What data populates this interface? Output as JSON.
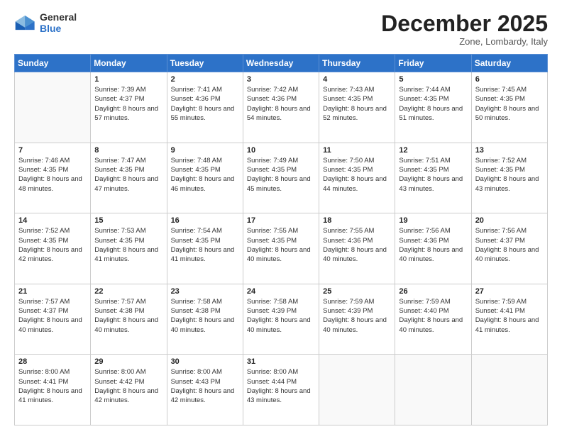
{
  "header": {
    "logo_line1": "General",
    "logo_line2": "Blue",
    "month": "December 2025",
    "location": "Zone, Lombardy, Italy"
  },
  "weekdays": [
    "Sunday",
    "Monday",
    "Tuesday",
    "Wednesday",
    "Thursday",
    "Friday",
    "Saturday"
  ],
  "weeks": [
    [
      {
        "day": "",
        "empty": true
      },
      {
        "day": "1",
        "sunrise": "7:39 AM",
        "sunset": "4:37 PM",
        "daylight": "8 hours and 57 minutes."
      },
      {
        "day": "2",
        "sunrise": "7:41 AM",
        "sunset": "4:36 PM",
        "daylight": "8 hours and 55 minutes."
      },
      {
        "day": "3",
        "sunrise": "7:42 AM",
        "sunset": "4:36 PM",
        "daylight": "8 hours and 54 minutes."
      },
      {
        "day": "4",
        "sunrise": "7:43 AM",
        "sunset": "4:35 PM",
        "daylight": "8 hours and 52 minutes."
      },
      {
        "day": "5",
        "sunrise": "7:44 AM",
        "sunset": "4:35 PM",
        "daylight": "8 hours and 51 minutes."
      },
      {
        "day": "6",
        "sunrise": "7:45 AM",
        "sunset": "4:35 PM",
        "daylight": "8 hours and 50 minutes."
      }
    ],
    [
      {
        "day": "7",
        "sunrise": "7:46 AM",
        "sunset": "4:35 PM",
        "daylight": "8 hours and 48 minutes."
      },
      {
        "day": "8",
        "sunrise": "7:47 AM",
        "sunset": "4:35 PM",
        "daylight": "8 hours and 47 minutes."
      },
      {
        "day": "9",
        "sunrise": "7:48 AM",
        "sunset": "4:35 PM",
        "daylight": "8 hours and 46 minutes."
      },
      {
        "day": "10",
        "sunrise": "7:49 AM",
        "sunset": "4:35 PM",
        "daylight": "8 hours and 45 minutes."
      },
      {
        "day": "11",
        "sunrise": "7:50 AM",
        "sunset": "4:35 PM",
        "daylight": "8 hours and 44 minutes."
      },
      {
        "day": "12",
        "sunrise": "7:51 AM",
        "sunset": "4:35 PM",
        "daylight": "8 hours and 43 minutes."
      },
      {
        "day": "13",
        "sunrise": "7:52 AM",
        "sunset": "4:35 PM",
        "daylight": "8 hours and 43 minutes."
      }
    ],
    [
      {
        "day": "14",
        "sunrise": "7:52 AM",
        "sunset": "4:35 PM",
        "daylight": "8 hours and 42 minutes."
      },
      {
        "day": "15",
        "sunrise": "7:53 AM",
        "sunset": "4:35 PM",
        "daylight": "8 hours and 41 minutes."
      },
      {
        "day": "16",
        "sunrise": "7:54 AM",
        "sunset": "4:35 PM",
        "daylight": "8 hours and 41 minutes."
      },
      {
        "day": "17",
        "sunrise": "7:55 AM",
        "sunset": "4:35 PM",
        "daylight": "8 hours and 40 minutes."
      },
      {
        "day": "18",
        "sunrise": "7:55 AM",
        "sunset": "4:36 PM",
        "daylight": "8 hours and 40 minutes."
      },
      {
        "day": "19",
        "sunrise": "7:56 AM",
        "sunset": "4:36 PM",
        "daylight": "8 hours and 40 minutes."
      },
      {
        "day": "20",
        "sunrise": "7:56 AM",
        "sunset": "4:37 PM",
        "daylight": "8 hours and 40 minutes."
      }
    ],
    [
      {
        "day": "21",
        "sunrise": "7:57 AM",
        "sunset": "4:37 PM",
        "daylight": "8 hours and 40 minutes."
      },
      {
        "day": "22",
        "sunrise": "7:57 AM",
        "sunset": "4:38 PM",
        "daylight": "8 hours and 40 minutes."
      },
      {
        "day": "23",
        "sunrise": "7:58 AM",
        "sunset": "4:38 PM",
        "daylight": "8 hours and 40 minutes."
      },
      {
        "day": "24",
        "sunrise": "7:58 AM",
        "sunset": "4:39 PM",
        "daylight": "8 hours and 40 minutes."
      },
      {
        "day": "25",
        "sunrise": "7:59 AM",
        "sunset": "4:39 PM",
        "daylight": "8 hours and 40 minutes."
      },
      {
        "day": "26",
        "sunrise": "7:59 AM",
        "sunset": "4:40 PM",
        "daylight": "8 hours and 40 minutes."
      },
      {
        "day": "27",
        "sunrise": "7:59 AM",
        "sunset": "4:41 PM",
        "daylight": "8 hours and 41 minutes."
      }
    ],
    [
      {
        "day": "28",
        "sunrise": "8:00 AM",
        "sunset": "4:41 PM",
        "daylight": "8 hours and 41 minutes."
      },
      {
        "day": "29",
        "sunrise": "8:00 AM",
        "sunset": "4:42 PM",
        "daylight": "8 hours and 42 minutes."
      },
      {
        "day": "30",
        "sunrise": "8:00 AM",
        "sunset": "4:43 PM",
        "daylight": "8 hours and 42 minutes."
      },
      {
        "day": "31",
        "sunrise": "8:00 AM",
        "sunset": "4:44 PM",
        "daylight": "8 hours and 43 minutes."
      },
      {
        "day": "",
        "empty": true
      },
      {
        "day": "",
        "empty": true
      },
      {
        "day": "",
        "empty": true
      }
    ]
  ],
  "labels": {
    "sunrise": "Sunrise:",
    "sunset": "Sunset:",
    "daylight": "Daylight:"
  }
}
